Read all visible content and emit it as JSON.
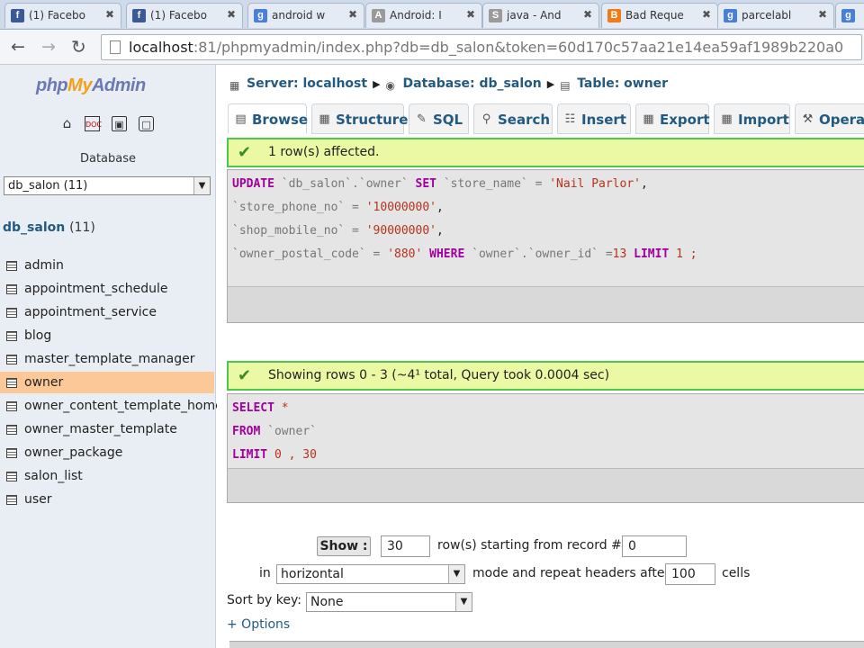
{
  "browser": {
    "tabs": [
      {
        "label": "(1) Facebo",
        "icon": "facebook-icon",
        "color": "#3b5998",
        "glyph": "f"
      },
      {
        "label": "(1) Facebo",
        "icon": "facebook-icon",
        "color": "#3b5998",
        "glyph": "f"
      },
      {
        "label": "android w",
        "icon": "google-icon",
        "color": "#4a7fd8",
        "glyph": "g"
      },
      {
        "label": "Android: I",
        "icon": "android-icon",
        "color": "#9a9a9a",
        "glyph": "A"
      },
      {
        "label": "java - And",
        "icon": "stackoverflow-icon",
        "color": "#9a9a9a",
        "glyph": "S"
      },
      {
        "label": "Bad Reque",
        "icon": "blogger-icon",
        "color": "#f07c18",
        "glyph": "B"
      },
      {
        "label": "parcelabl",
        "icon": "google-icon",
        "color": "#4a7fd8",
        "glyph": "g"
      },
      {
        "label": "",
        "icon": "google-icon",
        "color": "#4a7fd8",
        "glyph": "g"
      }
    ],
    "url_host": "localhost",
    "url_rest": ":81/phpmyadmin/index.php?db=db_salon&token=60d170c57aa21e14ea59af1989b220a0"
  },
  "sidebar": {
    "logo_php": "php",
    "logo_my": "My",
    "logo_admin": "Admin",
    "database_label": "Database",
    "db_select_value": "db_salon (11)",
    "db_name": "db_salon",
    "db_count": "(11)",
    "tables": [
      "admin",
      "appointment_schedule",
      "appointment_service",
      "blog",
      "master_template_manager",
      "owner",
      "owner_content_template_home",
      "owner_master_template",
      "owner_package",
      "salon_list",
      "user"
    ],
    "active_table": "owner"
  },
  "breadcrumb": {
    "server": "Server: localhost",
    "database": "Database: db_salon",
    "table": "Table: owner"
  },
  "tabs": [
    "Browse",
    "Structure",
    "SQL",
    "Search",
    "Insert",
    "Export",
    "Import",
    "Operat"
  ],
  "messages": {
    "update_msg": "1 row(s) affected.",
    "select_msg": "Showing rows 0 - 3 (~4¹ total, Query took 0.0004 sec)"
  },
  "update_sql": {
    "line1_kw": "UPDATE",
    "line1_id": " `db_salon`.`owner` ",
    "line1_kw2": "SET",
    "line1_id2": " `store_name` = ",
    "line1_str": "'Nail Parlor'",
    "line1_end": ",",
    "line2_id": "`store_phone_no` = ",
    "line2_str": "'10000000'",
    "line2_end": ",",
    "line3_id": "`shop_mobile_no` = ",
    "line3_str": "'90000000'",
    "line3_end": ",",
    "line4_id": "`owner_postal_code` = ",
    "line4_str": "'880'",
    "line4_kw": " WHERE ",
    "line4_id2": "`owner`.`owner_id` =",
    "line4_num": "13",
    "line4_kw2": " LIMIT ",
    "line4_num2": "1 ;"
  },
  "select_sql": {
    "line1_kw": "SELECT",
    "line1_rest": " *",
    "line2_kw": "FROM",
    "line2_id": " `owner`",
    "line3_kw": "LIMIT",
    "line3_num": " 0 , 30"
  },
  "controls": {
    "show_button": "Show :",
    "show_rows": "30",
    "rows_text": "row(s) starting from record #",
    "start_record": "0",
    "in_text": "in",
    "mode_value": "horizontal",
    "mode_text": "mode and repeat headers after",
    "headers_after": "100",
    "cells_text": "cells",
    "sort_label": "Sort by key:",
    "sort_value": "None",
    "options_link": "+ Options"
  }
}
